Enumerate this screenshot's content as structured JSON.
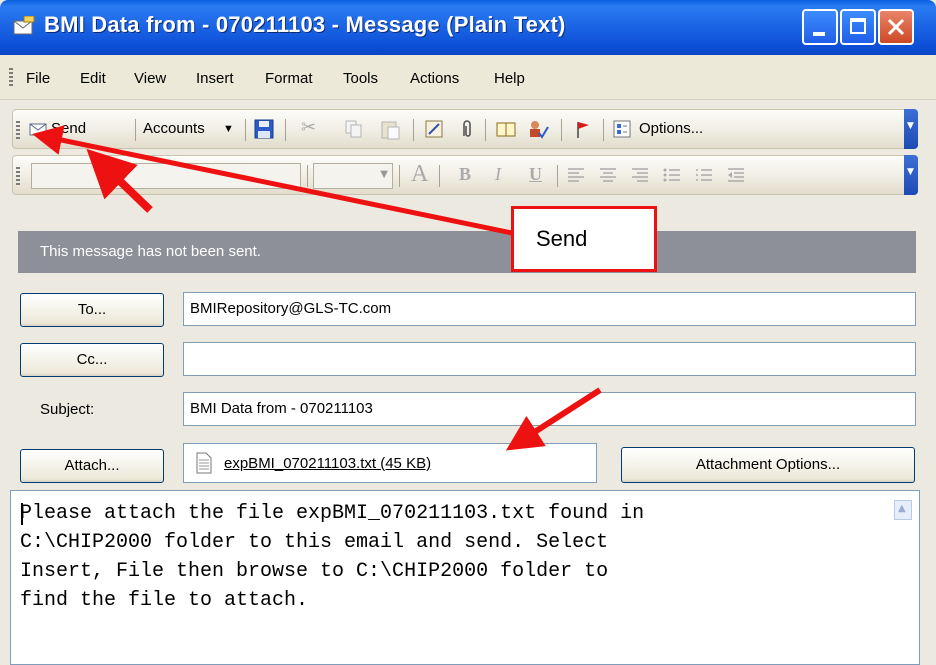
{
  "window": {
    "title": "BMI Data from - 070211103 - Message (Plain Text)"
  },
  "menubar": {
    "items": [
      "File",
      "Edit",
      "View",
      "Insert",
      "Format",
      "Tools",
      "Actions",
      "Help"
    ]
  },
  "toolbar": {
    "send_label": "Send",
    "accounts_label": "Accounts",
    "options_label": "Options..."
  },
  "format_toolbar": {
    "font_glyph": "A",
    "bold_glyph": "B",
    "italic_glyph": "I",
    "underline_glyph": "U"
  },
  "infobar": {
    "message": "This message has not been sent."
  },
  "header": {
    "to_button": "To...",
    "to_value": "BMIRepository@GLS-TC.com",
    "cc_button": "Cc...",
    "cc_value": "",
    "subject_label": "Subject:",
    "subject_value": "BMI Data from - 070211103",
    "attach_button": "Attach...",
    "attachment": "expBMI_070211103.txt (45 KB)",
    "attachment_options_button": "Attachment Options..."
  },
  "body": {
    "text": "Please attach the file expBMI_070211103.txt found in\nC:\\CHIP2000 folder to this email and send. Select\nInsert, File then browse to C:\\CHIP2000 folder to\nfind the file to attach."
  },
  "annotation": {
    "callout_label": "Send",
    "arrow_color": "#ee1111"
  }
}
